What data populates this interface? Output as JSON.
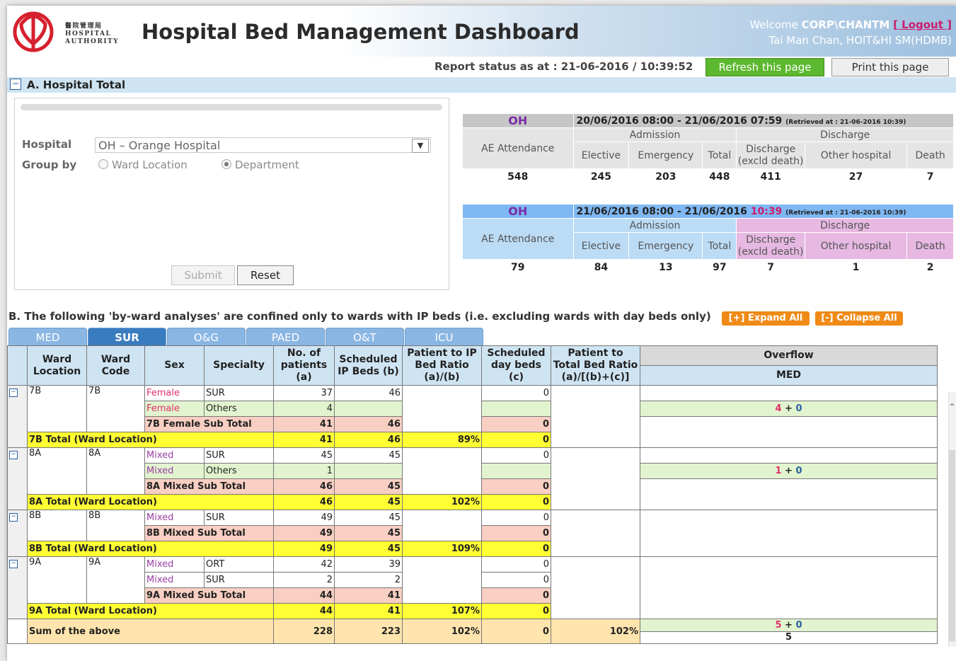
{
  "header": {
    "org_chinese": "醫院管理局",
    "org_line1": "HOSPITAL",
    "org_line2": "AUTHORITY",
    "title": "Hospital Bed Management Dashboard",
    "welcome_prefix": "Welcome",
    "user_id": "CORP\\CHANTM",
    "logout": "[ Logout ]",
    "user_name": "Tai Man Chan, HOIT&HI SM(HDMB)"
  },
  "status": {
    "report_status": "Report status as at : 21-06-2016 / 10:39:52",
    "refresh_label": "Refresh this page",
    "print_label": "Print this page"
  },
  "section_a": {
    "toggle": "−",
    "title": "A. Hospital Total",
    "hospital_label": "Hospital",
    "hospital_value": "OH – Orange Hospital",
    "dropdown_arrow": "▼",
    "group_by_label": "Group by",
    "radio_ward": "Ward Location",
    "radio_dept": "Department",
    "selected_group": "Department",
    "submit": "Submit",
    "reset": "Reset"
  },
  "stats_yesterday": {
    "hosp": "OH",
    "period": "20/06/2016 08:00 - 21/06/2016 07:59",
    "retrieved": "(Retrieved at : 21-06-2016 10:39)",
    "admission": "Admission",
    "discharge": "Discharge",
    "ae": "AE Attendance",
    "elective": "Elective",
    "emergency": "Emergency",
    "total": "Total",
    "discharge_excl": "Discharge (excld death)",
    "other_hospital": "Other hospital",
    "death": "Death",
    "values": [
      "548",
      "245",
      "203",
      "448",
      "411",
      "27",
      "7"
    ]
  },
  "stats_today": {
    "hosp": "OH",
    "period": "21/06/2016 08:00 - 21/06/2016",
    "period_time": "10:39",
    "retrieved": "(Retrieved at : 21-06-2016 10:39)",
    "admission": "Admission",
    "discharge": "Discharge",
    "ae": "AE Attendance",
    "elective": "Elective",
    "emergency": "Emergency",
    "total": "Total",
    "discharge_excl": "Discharge (excld death)",
    "other_hospital": "Other hospital",
    "death": "Death",
    "values": [
      "79",
      "84",
      "13",
      "97",
      "7",
      "1",
      "2"
    ]
  },
  "section_b": {
    "title": "B. The following 'by-ward analyses' are confined only to wards with IP beds (i.e. excluding wards with day beds only)",
    "expand_all": "[+] Expand All",
    "collapse_all": "[-] Collapse All",
    "tabs": [
      "MED",
      "SUR",
      "O&G",
      "PAED",
      "O&T",
      "ICU"
    ],
    "active_tab": "SUR"
  },
  "table": {
    "headers": {
      "ward_location": "Ward Location",
      "ward_code": "Ward Code",
      "sex": "Sex",
      "specialty": "Specialty",
      "patients": "No. of patients (a)",
      "ip_beds": "Scheduled IP Beds (b)",
      "ip_ratio": "Patient to IP Bed Ratio (a)/(b)",
      "day_beds": "Scheduled day beds (c)",
      "total_ratio": "Patient to Total Bed Ratio (a)/[(b)+(c)]",
      "overflow": "Overflow",
      "overflow_sub": "MED"
    },
    "toggle": "−",
    "plus": "+",
    "w7b": {
      "loc": "7B",
      "code": "7B",
      "r1": {
        "sex": "Female",
        "spec": "SUR",
        "a": "37",
        "b": "46",
        "c": "0"
      },
      "r2": {
        "sex": "Female",
        "spec": "Others",
        "a": "4",
        "ovf_a": "4",
        "ovf_b": "0"
      },
      "sub": {
        "label": "7B Female Sub Total",
        "a": "41",
        "b": "46",
        "c": "0"
      },
      "tot": {
        "label": "7B Total (Ward Location)",
        "a": "41",
        "b": "46",
        "ratio": "89%",
        "c": "0"
      }
    },
    "w8a": {
      "loc": "8A",
      "code": "8A",
      "r1": {
        "sex": "Mixed",
        "spec": "SUR",
        "a": "45",
        "b": "45",
        "c": "0"
      },
      "r2": {
        "sex": "Mixed",
        "spec": "Others",
        "a": "1",
        "ovf_a": "1",
        "ovf_b": "0"
      },
      "sub": {
        "label": "8A Mixed Sub Total",
        "a": "46",
        "b": "45",
        "c": "0"
      },
      "tot": {
        "label": "8A Total (Ward Location)",
        "a": "46",
        "b": "45",
        "ratio": "102%",
        "c": "0"
      }
    },
    "w8b": {
      "loc": "8B",
      "code": "8B",
      "r1": {
        "sex": "Mixed",
        "spec": "SUR",
        "a": "49",
        "b": "45",
        "c": "0"
      },
      "sub": {
        "label": "8B Mixed Sub Total",
        "a": "49",
        "b": "45",
        "c": "0"
      },
      "tot": {
        "label": "8B Total (Ward Location)",
        "a": "49",
        "b": "45",
        "ratio": "109%",
        "c": "0"
      }
    },
    "w9a": {
      "loc": "9A",
      "code": "9A",
      "r1": {
        "sex": "Mixed",
        "spec": "ORT",
        "a": "42",
        "b": "39",
        "c": "0"
      },
      "r2": {
        "sex": "Mixed",
        "spec": "SUR",
        "a": "2",
        "b": "2",
        "c": "0"
      },
      "sub": {
        "label": "9A Mixed Sub Total",
        "a": "44",
        "b": "41",
        "c": "0"
      },
      "tot": {
        "label": "9A Total (Ward Location)",
        "a": "44",
        "b": "41",
        "ratio": "107%",
        "c": "0"
      }
    },
    "sum": {
      "label": "Sum of the above",
      "a": "228",
      "b": "223",
      "ratio": "102%",
      "c": "0",
      "total_ratio": "102%",
      "ovf_a": "5",
      "ovf_b": "0",
      "ovf_total": "5"
    }
  },
  "colors": {
    "accent": "#3a7cc0",
    "refresh": "#5cb82e",
    "orange": "#f08a16",
    "yellow": "#ffff33",
    "pink": "#f8cfc2",
    "green": "#e2f4cf",
    "logo_red": "#d6202e"
  }
}
